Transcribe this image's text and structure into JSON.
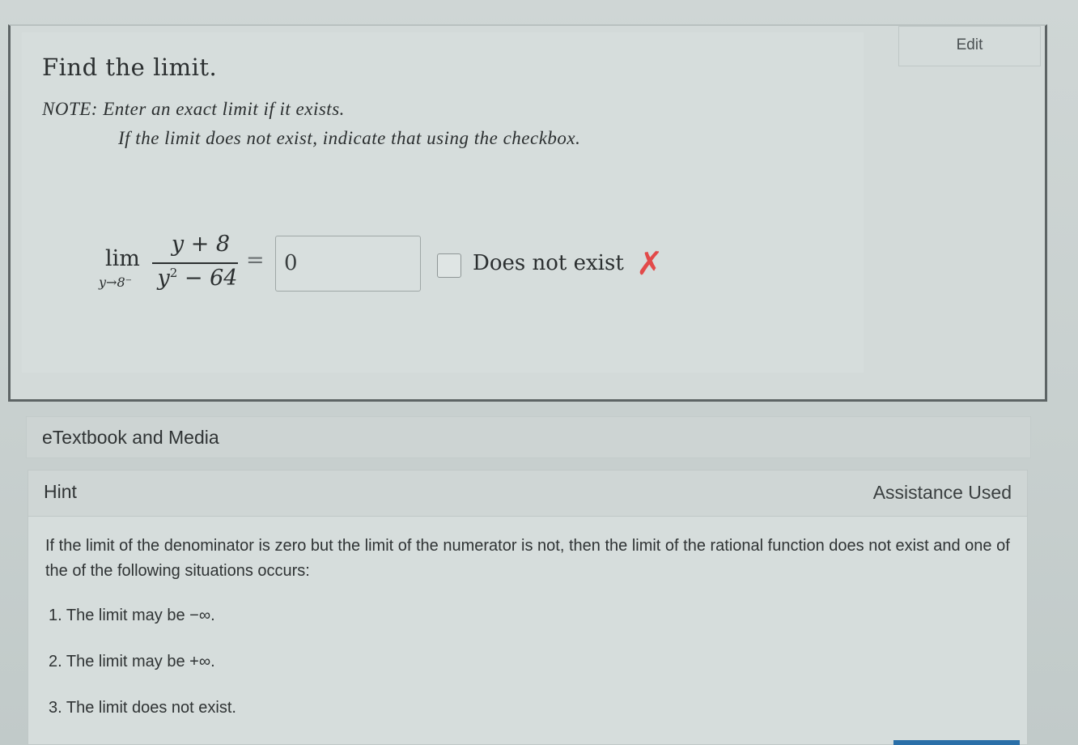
{
  "question": {
    "edit_label": "Edit",
    "title": "Find the limit.",
    "note_line1": "NOTE: Enter an exact limit if it exists.",
    "note_line2": "If the limit does not exist, indicate that using the checkbox.",
    "expression": {
      "lim": "lim",
      "subscript": "y→8⁻",
      "numerator": "y + 8",
      "denominator_base": "y",
      "denominator_exp": "2",
      "denominator_rest": " − 64",
      "equals": "="
    },
    "answer_value": "0",
    "checkbox_label": "Does not exist",
    "result_icon": "x-mark-icon",
    "result_color": "#e24a4a"
  },
  "etextbook": {
    "label": "eTextbook and Media"
  },
  "hint": {
    "title": "Hint",
    "assistance_label": "Assistance Used",
    "text": "If the limit of the denominator is zero but the limit of the numerator is not, then the limit of the rational function does not exist and one of the of the following situations occurs:",
    "items": [
      "1. The limit may be −∞.",
      "2. The limit may be +∞.",
      "3. The limit does not exist."
    ]
  }
}
